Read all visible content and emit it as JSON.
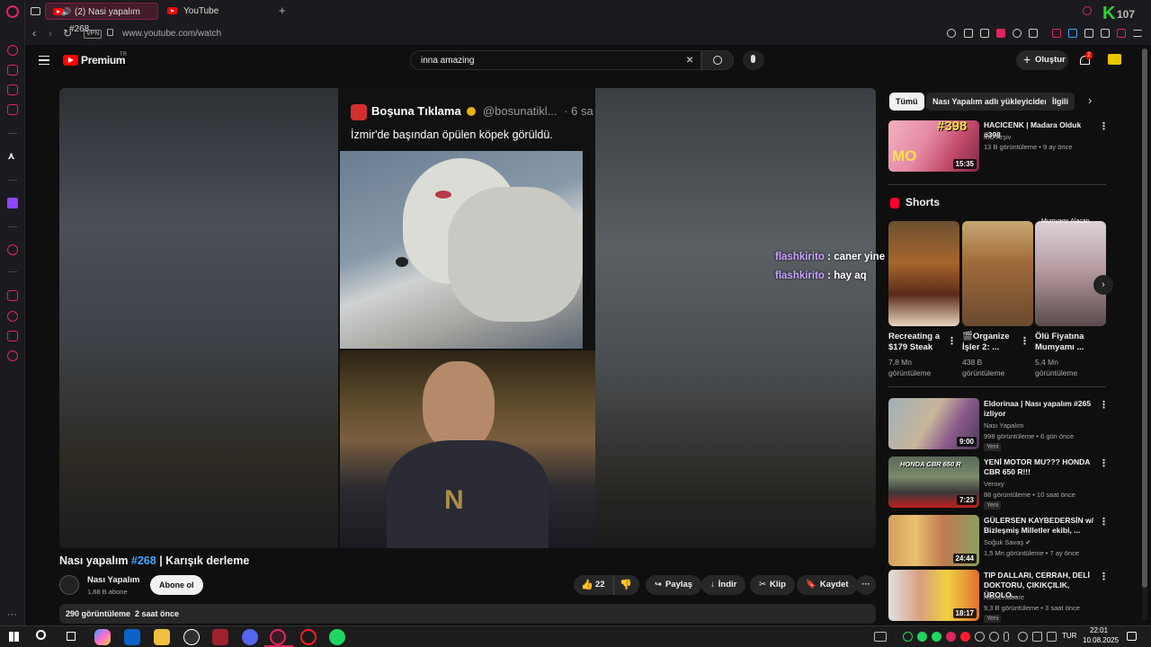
{
  "browser": {
    "tabs": [
      {
        "label": "(2) Nasi yapalım #268",
        "active": true
      },
      {
        "label": "YouTube",
        "active": false
      }
    ],
    "new_tab_label": "+",
    "vpn_label": "VPN",
    "url": "www.youtube.com/watch",
    "accent_color": "#e0245e"
  },
  "youtube": {
    "logo_text": "Premium",
    "logo_sup": "TR",
    "search_value": "inna amazing",
    "create_label": "Oluştur",
    "notification_count": "2"
  },
  "player": {
    "tweet_name": "Boşuna Tıklama",
    "tweet_handle": "@bosunatikl...",
    "tweet_time": "· 6 sa",
    "tweet_text": "İzmir'de başından öpülen köpek görüldü.",
    "chat": [
      {
        "user": "flashkirito",
        "text": ": caner yine kırmızı yemiş"
      },
      {
        "user": "flashkirito",
        "text": ": hay aq"
      }
    ]
  },
  "video": {
    "title_prefix": "Nası yapalım ",
    "title_tag": "#268",
    "title_suffix": " | Karışık derleme",
    "channel_name": "Nası Yapalım",
    "subscribers": "1,88 B abone",
    "subscribe_label": "Abone ol",
    "likes": "22",
    "share_label": "Paylaş",
    "download_label": "İndir",
    "clip_label": "Klip",
    "save_label": "Kaydet",
    "views_time": "290 görüntüleme  2 saat önce"
  },
  "sidebar": {
    "chips": [
      "Tümü",
      "Nası Yapalım adlı yükleyiciden",
      "İlgili"
    ],
    "shorts_heading": "Shorts",
    "shorts_top_caption": "Mumyamı Alacan",
    "first_rec": {
      "title": "HACICENK | Madara Olduk #398",
      "channel": "MO Arşiv",
      "meta": "13 B görüntüleme • 9 ay önce",
      "duration": "15:35",
      "thumb_text": "#398"
    },
    "shorts": [
      {
        "title": "Recreating a $179 Steak",
        "views": "7,8 Mn görüntüleme"
      },
      {
        "title": "🎬Organize İşler 2: ...",
        "views": "438 B görüntüleme"
      },
      {
        "title": "Ölü Fiyatına Mumyamı ...",
        "views": "5,4 Mn görüntüleme"
      }
    ],
    "recs": [
      {
        "title": "Eldorinaa | Nası yapalım #265 izliyor",
        "channel": "Nası Yapalım",
        "meta": "998 görüntüleme • 6 gün önce",
        "duration": "9:00",
        "badge": "Yeni"
      },
      {
        "title": "YENİ MOTOR MU??? HONDA CBR 650 R!!!",
        "channel": "Veroxy",
        "meta": "88 görüntüleme • 10 saat önce",
        "duration": "7:23",
        "badge": "Yeni",
        "thumb_text": "HONDA CBR 650 R"
      },
      {
        "title": "GÜLERSEN KAYBEDERSİN w/ Bizleşmiş Milletler ekibi, ...",
        "channel": "Soğuk Savaş ✔",
        "meta": "1,5 Mn görüntüleme • 7 ay önce",
        "duration": "24:44"
      },
      {
        "title": "TIP DALLARI, CERRAH, DELİ DOKTORU, ÇIKIKÇILIK, ÜROLO...",
        "channel": "Kukla Kabare",
        "meta": "9,3 B görüntüleme • 3 saat önce",
        "duration": "18:17",
        "badge": "Yeni"
      }
    ]
  },
  "taskbar": {
    "lang": "TUR",
    "time": "22:01",
    "date": "10.08.2025",
    "corner_logo": "K",
    "corner_logo_num": "107"
  }
}
